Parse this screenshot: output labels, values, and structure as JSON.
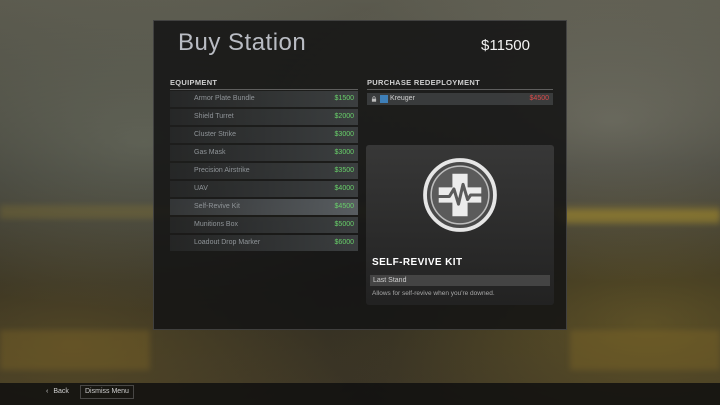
{
  "buy_station": {
    "title": "Buy Station",
    "money": "$11500"
  },
  "equipment": {
    "header": "EQUIPMENT",
    "items": [
      {
        "name": "Armor Plate Bundle",
        "price": "$1500"
      },
      {
        "name": "Shield Turret",
        "price": "$2000"
      },
      {
        "name": "Cluster Strike",
        "price": "$3000"
      },
      {
        "name": "Gas Mask",
        "price": "$3000"
      },
      {
        "name": "Precision Airstrike",
        "price": "$3500"
      },
      {
        "name": "UAV",
        "price": "$4000"
      },
      {
        "name": "Self-Revive Kit",
        "price": "$4500"
      },
      {
        "name": "Munitions Box",
        "price": "$5000"
      },
      {
        "name": "Loadout Drop Marker",
        "price": "$6000"
      }
    ]
  },
  "redeployment": {
    "header": "PURCHASE REDEPLOYMENT",
    "player": {
      "name": "Kreuger",
      "price": "$4500",
      "icon": "lock-icon"
    }
  },
  "detail_card": {
    "icon": "self-revive-kit-icon",
    "title": "SELF-REVIVE KIT",
    "subtitle": "Last Stand",
    "description": "Allows for self-revive when you're downed."
  },
  "footer": {
    "back_label": "Back",
    "dismiss_label": "Dismiss Menu"
  },
  "colors": {
    "price_affordable": "#68d06a",
    "price_unaffordable": "#d94a4a",
    "team_badge": "#3e7fb8"
  }
}
